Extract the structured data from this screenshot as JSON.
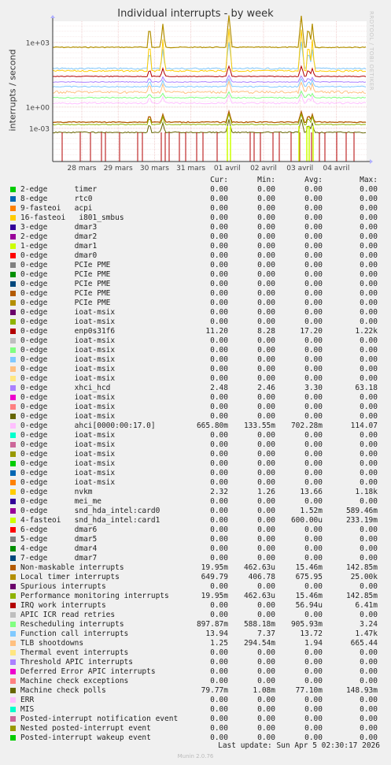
{
  "title": "Individual interrupts - by week",
  "watermark": "RRDTOOL / TOBI OETIKER",
  "footer": {
    "last_update": "Last update: Sun Apr  5 02:30:17 2026",
    "version": "Munin 2.0.76"
  },
  "legend_headers": {
    "cur": "Cur:",
    "min": "Min:",
    "avg": "Avg:",
    "max": "Max:"
  },
  "chart_data": {
    "type": "line",
    "title": "Individual interrupts - by week",
    "ylabel": "interrupts / second",
    "yscale": "log",
    "y_ticks": [
      "1e+03",
      "1e+00",
      "1e-03"
    ],
    "x_ticks": [
      "28 mars",
      "29 mars",
      "30 mars",
      "31 mars",
      "01 avril",
      "02 avril",
      "03 avril",
      "04 avril"
    ],
    "grid": true,
    "series": [
      {
        "name": "2-edge      timer",
        "color": "#00cc00",
        "cur": "0.00",
        "min": "0.00",
        "avg": "0.00",
        "max": "0.00"
      },
      {
        "name": "8-edge      rtc0",
        "color": "#0066b3",
        "cur": "0.00",
        "min": "0.00",
        "avg": "0.00",
        "max": "0.00"
      },
      {
        "name": "9-fasteoi   acpi",
        "color": "#ff8000",
        "cur": "0.00",
        "min": "0.00",
        "avg": "0.00",
        "max": "0.00"
      },
      {
        "name": "16-fasteoi   i801_smbus",
        "color": "#ffcc00",
        "cur": "0.00",
        "min": "0.00",
        "avg": "0.00",
        "max": "0.00"
      },
      {
        "name": "3-edge      dmar3",
        "color": "#330099",
        "cur": "0.00",
        "min": "0.00",
        "avg": "0.00",
        "max": "0.00"
      },
      {
        "name": "2-edge      dmar2",
        "color": "#990099",
        "cur": "0.00",
        "min": "0.00",
        "avg": "0.00",
        "max": "0.00"
      },
      {
        "name": "1-edge      dmar1",
        "color": "#ccff00",
        "cur": "0.00",
        "min": "0.00",
        "avg": "0.00",
        "max": "0.00"
      },
      {
        "name": "0-edge      dmar0",
        "color": "#ff0000",
        "cur": "0.00",
        "min": "0.00",
        "avg": "0.00",
        "max": "0.00"
      },
      {
        "name": "0-edge      PCIe PME",
        "color": "#808080",
        "cur": "0.00",
        "min": "0.00",
        "avg": "0.00",
        "max": "0.00"
      },
      {
        "name": "0-edge      PCIe PME",
        "color": "#008f00",
        "cur": "0.00",
        "min": "0.00",
        "avg": "0.00",
        "max": "0.00"
      },
      {
        "name": "0-edge      PCIe PME",
        "color": "#00487d",
        "cur": "0.00",
        "min": "0.00",
        "avg": "0.00",
        "max": "0.00"
      },
      {
        "name": "0-edge      PCIe PME",
        "color": "#b35a00",
        "cur": "0.00",
        "min": "0.00",
        "avg": "0.00",
        "max": "0.00"
      },
      {
        "name": "0-edge      PCIe PME",
        "color": "#b38f00",
        "cur": "0.00",
        "min": "0.00",
        "avg": "0.00",
        "max": "0.00"
      },
      {
        "name": "0-edge      ioat-msix",
        "color": "#6b006b",
        "cur": "0.00",
        "min": "0.00",
        "avg": "0.00",
        "max": "0.00"
      },
      {
        "name": "0-edge      ioat-msix",
        "color": "#8fb300",
        "cur": "0.00",
        "min": "0.00",
        "avg": "0.00",
        "max": "0.00"
      },
      {
        "name": "0-edge      enp0s31f6",
        "color": "#b30000",
        "cur": "11.20",
        "min": "8.28",
        "avg": "17.20",
        "max": "1.22k"
      },
      {
        "name": "0-edge      ioat-msix",
        "color": "#bebebe",
        "cur": "0.00",
        "min": "0.00",
        "avg": "0.00",
        "max": "0.00"
      },
      {
        "name": "0-edge      ioat-msix",
        "color": "#80ff80",
        "cur": "0.00",
        "min": "0.00",
        "avg": "0.00",
        "max": "0.00"
      },
      {
        "name": "0-edge      ioat-msix",
        "color": "#80c9ff",
        "cur": "0.00",
        "min": "0.00",
        "avg": "0.00",
        "max": "0.00"
      },
      {
        "name": "0-edge      ioat-msix",
        "color": "#ffc080",
        "cur": "0.00",
        "min": "0.00",
        "avg": "0.00",
        "max": "0.00"
      },
      {
        "name": "0-edge      ioat-msix",
        "color": "#ffe680",
        "cur": "0.00",
        "min": "0.00",
        "avg": "0.00",
        "max": "0.00"
      },
      {
        "name": "0-edge      xhci_hcd",
        "color": "#aa80ff",
        "cur": "2.48",
        "min": "2.46",
        "avg": "3.30",
        "max": "63.18"
      },
      {
        "name": "0-edge      ioat-msix",
        "color": "#ee00cc",
        "cur": "0.00",
        "min": "0.00",
        "avg": "0.00",
        "max": "0.00"
      },
      {
        "name": "0-edge      ioat-msix",
        "color": "#ff8080",
        "cur": "0.00",
        "min": "0.00",
        "avg": "0.00",
        "max": "0.00"
      },
      {
        "name": "0-edge      ioat-msix",
        "color": "#666600",
        "cur": "0.00",
        "min": "0.00",
        "avg": "0.00",
        "max": "0.00"
      },
      {
        "name": "0-edge      ahci[0000:00:17.0]",
        "color": "#ffbfff",
        "cur": "665.80m",
        "min": "133.55m",
        "avg": "702.28m",
        "max": "114.07"
      },
      {
        "name": "0-edge      ioat-msix",
        "color": "#00ffcc",
        "cur": "0.00",
        "min": "0.00",
        "avg": "0.00",
        "max": "0.00"
      },
      {
        "name": "0-edge      ioat-msix",
        "color": "#cc6699",
        "cur": "0.00",
        "min": "0.00",
        "avg": "0.00",
        "max": "0.00"
      },
      {
        "name": "0-edge      ioat-msix",
        "color": "#999900",
        "cur": "0.00",
        "min": "0.00",
        "avg": "0.00",
        "max": "0.00"
      },
      {
        "name": "0-edge      ioat-msix",
        "color": "#00cc00",
        "cur": "0.00",
        "min": "0.00",
        "avg": "0.00",
        "max": "0.00"
      },
      {
        "name": "0-edge      ioat-msix",
        "color": "#0066b3",
        "cur": "0.00",
        "min": "0.00",
        "avg": "0.00",
        "max": "0.00"
      },
      {
        "name": "0-edge      ioat-msix",
        "color": "#ff8000",
        "cur": "0.00",
        "min": "0.00",
        "avg": "0.00",
        "max": "0.00"
      },
      {
        "name": "0-edge      nvkm",
        "color": "#ffcc00",
        "cur": "2.32",
        "min": "1.26",
        "avg": "13.66",
        "max": "1.18k"
      },
      {
        "name": "0-edge      mei_me",
        "color": "#330099",
        "cur": "0.00",
        "min": "0.00",
        "avg": "0.00",
        "max": "0.00"
      },
      {
        "name": "0-edge      snd_hda_intel:card0",
        "color": "#990099",
        "cur": "0.00",
        "min": "0.00",
        "avg": "1.52m",
        "max": "589.46m"
      },
      {
        "name": "4-fasteoi   snd_hda_intel:card1",
        "color": "#ccff00",
        "cur": "0.00",
        "min": "0.00",
        "avg": "600.00u",
        "max": "233.19m"
      },
      {
        "name": "6-edge      dmar6",
        "color": "#ff0000",
        "cur": "0.00",
        "min": "0.00",
        "avg": "0.00",
        "max": "0.00"
      },
      {
        "name": "5-edge      dmar5",
        "color": "#808080",
        "cur": "0.00",
        "min": "0.00",
        "avg": "0.00",
        "max": "0.00"
      },
      {
        "name": "4-edge      dmar4",
        "color": "#008f00",
        "cur": "0.00",
        "min": "0.00",
        "avg": "0.00",
        "max": "0.00"
      },
      {
        "name": "7-edge      dmar7",
        "color": "#00487d",
        "cur": "0.00",
        "min": "0.00",
        "avg": "0.00",
        "max": "0.00"
      },
      {
        "name": "Non-maskable interrupts",
        "color": "#b35a00",
        "cur": "19.95m",
        "min": "462.63u",
        "avg": "15.46m",
        "max": "142.85m"
      },
      {
        "name": "Local timer interrupts",
        "color": "#b38f00",
        "cur": "649.79",
        "min": "406.78",
        "avg": "675.95",
        "max": "25.00k"
      },
      {
        "name": "Spurious interrupts",
        "color": "#6b006b",
        "cur": "0.00",
        "min": "0.00",
        "avg": "0.00",
        "max": "0.00"
      },
      {
        "name": "Performance monitoring interrupts",
        "color": "#8fb300",
        "cur": "19.95m",
        "min": "462.63u",
        "avg": "15.46m",
        "max": "142.85m"
      },
      {
        "name": "IRQ work interrupts",
        "color": "#b30000",
        "cur": "0.00",
        "min": "0.00",
        "avg": "56.94u",
        "max": "6.41m"
      },
      {
        "name": "APIC ICR read retries",
        "color": "#bebebe",
        "cur": "0.00",
        "min": "0.00",
        "avg": "0.00",
        "max": "0.00"
      },
      {
        "name": "Rescheduling interrupts",
        "color": "#80ff80",
        "cur": "897.87m",
        "min": "588.18m",
        "avg": "905.93m",
        "max": "3.24"
      },
      {
        "name": "Function call interrupts",
        "color": "#80c9ff",
        "cur": "13.94",
        "min": "7.37",
        "avg": "13.72",
        "max": "1.47k"
      },
      {
        "name": "TLB shootdowns",
        "color": "#ffc080",
        "cur": "1.25",
        "min": "294.54m",
        "avg": "1.94",
        "max": "665.44"
      },
      {
        "name": "Thermal event interrupts",
        "color": "#ffe680",
        "cur": "0.00",
        "min": "0.00",
        "avg": "0.00",
        "max": "0.00"
      },
      {
        "name": "Threshold APIC interrupts",
        "color": "#aa80ff",
        "cur": "0.00",
        "min": "0.00",
        "avg": "0.00",
        "max": "0.00"
      },
      {
        "name": "Deferred Error APIC interrupts",
        "color": "#ee00cc",
        "cur": "0.00",
        "min": "0.00",
        "avg": "0.00",
        "max": "0.00"
      },
      {
        "name": "Machine check exceptions",
        "color": "#ff8080",
        "cur": "0.00",
        "min": "0.00",
        "avg": "0.00",
        "max": "0.00"
      },
      {
        "name": "Machine check polls",
        "color": "#666600",
        "cur": "79.77m",
        "min": "1.08m",
        "avg": "77.10m",
        "max": "148.93m"
      },
      {
        "name": "ERR",
        "color": "#ffbfff",
        "cur": "0.00",
        "min": "0.00",
        "avg": "0.00",
        "max": "0.00"
      },
      {
        "name": "MIS",
        "color": "#00ffcc",
        "cur": "0.00",
        "min": "0.00",
        "avg": "0.00",
        "max": "0.00"
      },
      {
        "name": "Posted-interrupt notification event",
        "color": "#cc6699",
        "cur": "0.00",
        "min": "0.00",
        "avg": "0.00",
        "max": "0.00"
      },
      {
        "name": "Nested posted-interrupt event",
        "color": "#999900",
        "cur": "0.00",
        "min": "0.00",
        "avg": "0.00",
        "max": "0.00"
      },
      {
        "name": "Posted-interrupt wakeup event",
        "color": "#00cc00",
        "cur": "0.00",
        "min": "0.00",
        "avg": "0.00",
        "max": "0.00"
      }
    ]
  }
}
